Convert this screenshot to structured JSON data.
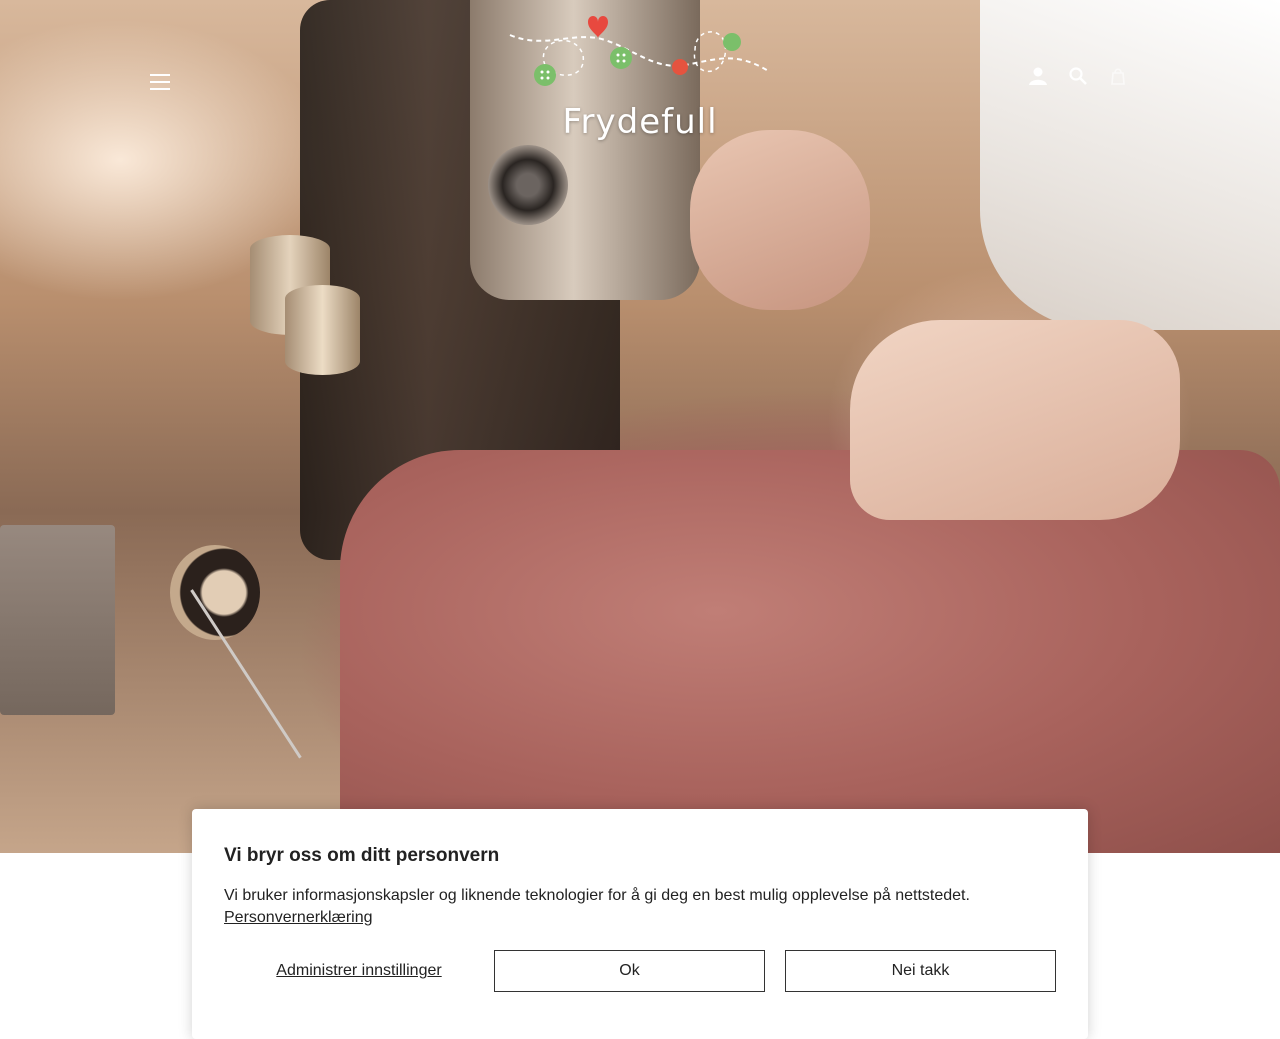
{
  "header": {
    "menu_icon": "hamburger-menu-icon",
    "logo_text": "Frydefull",
    "icons": [
      "user-icon",
      "search-icon",
      "cart-icon"
    ]
  },
  "hero": {
    "image_description_alt": ""
  },
  "cookie_dialog": {
    "title": "Vi bryr oss om ditt personvern",
    "body": "Vi bruker informasjonskapsler og liknende teknologier for å gi deg en best mulig opplevelse på nettstedet.",
    "privacy_link": "Personvernerklæring",
    "manage_link": "Administrer innstillinger",
    "ok_button": "Ok",
    "decline_button": "Nei takk"
  },
  "colors": {
    "logo_heart": "#e8493f",
    "logo_button_green": "#7bbf6a",
    "logo_button_red": "#e5533f",
    "dialog_border": "#333333"
  }
}
